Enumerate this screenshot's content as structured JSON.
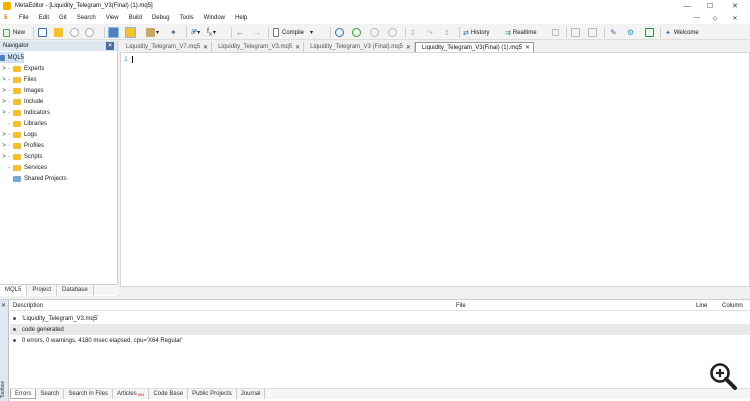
{
  "window": {
    "title": "MetaEditor - [Liquidity_Telegram_V3(Final) (1).mq5]",
    "controls": [
      "—",
      "☐",
      "✕"
    ]
  },
  "menu": {
    "logo": "5",
    "items": [
      "File",
      "Edit",
      "Git",
      "Search",
      "View",
      "Build",
      "Debug",
      "Tools",
      "Window",
      "Help"
    ],
    "right": [
      "—",
      "&#8729;",
      "✕"
    ]
  },
  "toolbar": {
    "new_label": "New",
    "compile_label": "Compile",
    "history_label": "History",
    "realtime_label": "Realtime",
    "welcome_label": "Welcome"
  },
  "navigator": {
    "title": "Navigator",
    "root": "MQL5",
    "items": [
      "Experts",
      "Files",
      "Images",
      "Include",
      "Indicators",
      "Libraries",
      "Logs",
      "Profiles",
      "Scripts",
      "Services",
      "Shared Projects"
    ],
    "tabs": [
      "MQL5",
      "Project",
      "Database"
    ]
  },
  "tabs": [
    "Liquidity_Telegram_V7.mq5",
    "Liquidity_Telegram_V3.mq5",
    "Liquidity_Telegram_V3 (Final).mq5",
    "Liquidity_Telegram_V3(Final) (1).mq5"
  ],
  "editor": {
    "line_number": "1"
  },
  "toolbox": {
    "label": "Toolbox",
    "columns": {
      "description": "Description",
      "file": "File",
      "line": "Line",
      "column": "Column"
    },
    "rows": [
      "'Liquidity_Telegram_V3.mq5'",
      "code generated",
      "0 errors, 0 warnings, 4180 msec elapsed, cpu='X64 Regular'"
    ],
    "tabs": [
      "Errors",
      "Search",
      "Search in Files",
      "Articles",
      "Code Base",
      "Public Projects",
      "Journal"
    ],
    "articles_badge": "888"
  }
}
